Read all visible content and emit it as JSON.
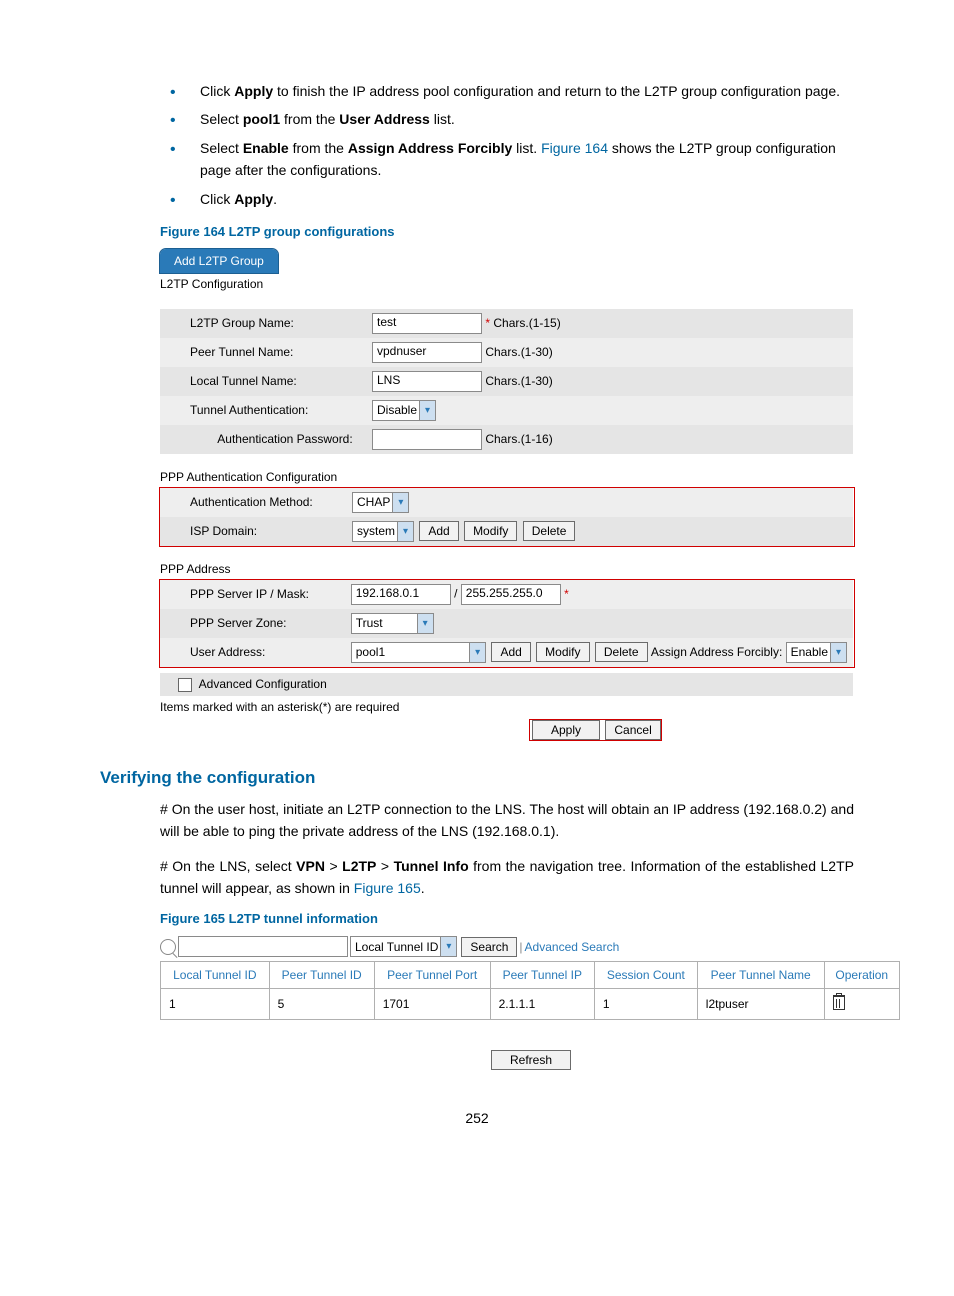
{
  "bullets": [
    {
      "pre": "Click ",
      "b1": "Apply",
      "post": " to finish the IP address pool configuration and return to the L2TP group configuration page."
    },
    {
      "pre": "Select ",
      "b1": "pool1",
      "mid": " from the ",
      "b2": "User Address",
      "post": " list."
    },
    {
      "pre": "Select ",
      "b1": "Enable",
      "mid": " from the ",
      "b2": "Assign Address Forcibly",
      "mid2": " list. ",
      "link": "Figure 164",
      "post": " shows the L2TP group configuration page after the configurations."
    },
    {
      "pre": "Click ",
      "b1": "Apply",
      "post": "."
    }
  ],
  "fig164": {
    "caption": "Figure 164 L2TP group configurations",
    "tab": "Add L2TP Group",
    "section_l2tp": "L2TP Configuration",
    "rows": {
      "group_name_label": "L2TP Group Name:",
      "group_name_value": "test",
      "group_name_hint": "Chars.(1-15)",
      "peer_tunnel_label": "Peer Tunnel Name:",
      "peer_tunnel_value": "vpdnuser",
      "peer_tunnel_hint": "Chars.(1-30)",
      "local_tunnel_label": "Local Tunnel Name:",
      "local_tunnel_value": "LNS",
      "local_tunnel_hint": "Chars.(1-30)",
      "tunnel_auth_label": "Tunnel Authentication:",
      "tunnel_auth_value": "Disable",
      "auth_pw_label": "Authentication Password:",
      "auth_pw_value": "",
      "auth_pw_hint": "Chars.(1-16)"
    },
    "section_ppp_auth": "PPP Authentication Configuration",
    "ppp": {
      "auth_method_label": "Authentication Method:",
      "auth_method_value": "CHAP",
      "isp_label": "ISP Domain:",
      "isp_value": "system",
      "add": "Add",
      "modify": "Modify",
      "delete": "Delete"
    },
    "section_ppp_addr": "PPP Address",
    "addr": {
      "server_ip_label": "PPP Server IP / Mask:",
      "server_ip_value": "192.168.0.1",
      "server_mask_value": "255.255.255.0",
      "slash": "/",
      "zone_label": "PPP Server Zone:",
      "zone_value": "Trust",
      "user_addr_label": "User Address:",
      "user_addr_value": "pool1",
      "add": "Add",
      "modify": "Modify",
      "delete": "Delete",
      "assign_label": "Assign Address Forcibly:",
      "assign_value": "Enable"
    },
    "advanced": "Advanced Configuration",
    "footnote": "Items marked with an asterisk(*) are required",
    "apply": "Apply",
    "cancel": "Cancel"
  },
  "verify": {
    "heading": "Verifying the configuration",
    "p1": "# On the user host, initiate an L2TP connection to the LNS. The host will obtain an IP address (192.168.0.2) and will be able to ping the private address of the LNS (192.168.0.1).",
    "p2_a": "# On the LNS, select ",
    "p2_b1": "VPN",
    "p2_s1": " > ",
    "p2_b2": "L2TP",
    "p2_s2": " > ",
    "p2_b3": "Tunnel Info",
    "p2_c": " from the navigation tree. Information of the established L2TP tunnel will appear, as shown in ",
    "p2_link": "Figure 165",
    "p2_end": "."
  },
  "fig165": {
    "caption": "Figure 165 L2TP tunnel information",
    "search_field": "Local Tunnel ID",
    "search_btn": "Search",
    "advanced_search": "Advanced Search",
    "headers": [
      "Local Tunnel ID",
      "Peer Tunnel ID",
      "Peer Tunnel Port",
      "Peer Tunnel IP",
      "Session Count",
      "Peer Tunnel Name",
      "Operation"
    ],
    "row": [
      "1",
      "5",
      "1701",
      "2.1.1.1",
      "1",
      "l2tpuser"
    ],
    "refresh": "Refresh"
  },
  "pagenum": "252"
}
